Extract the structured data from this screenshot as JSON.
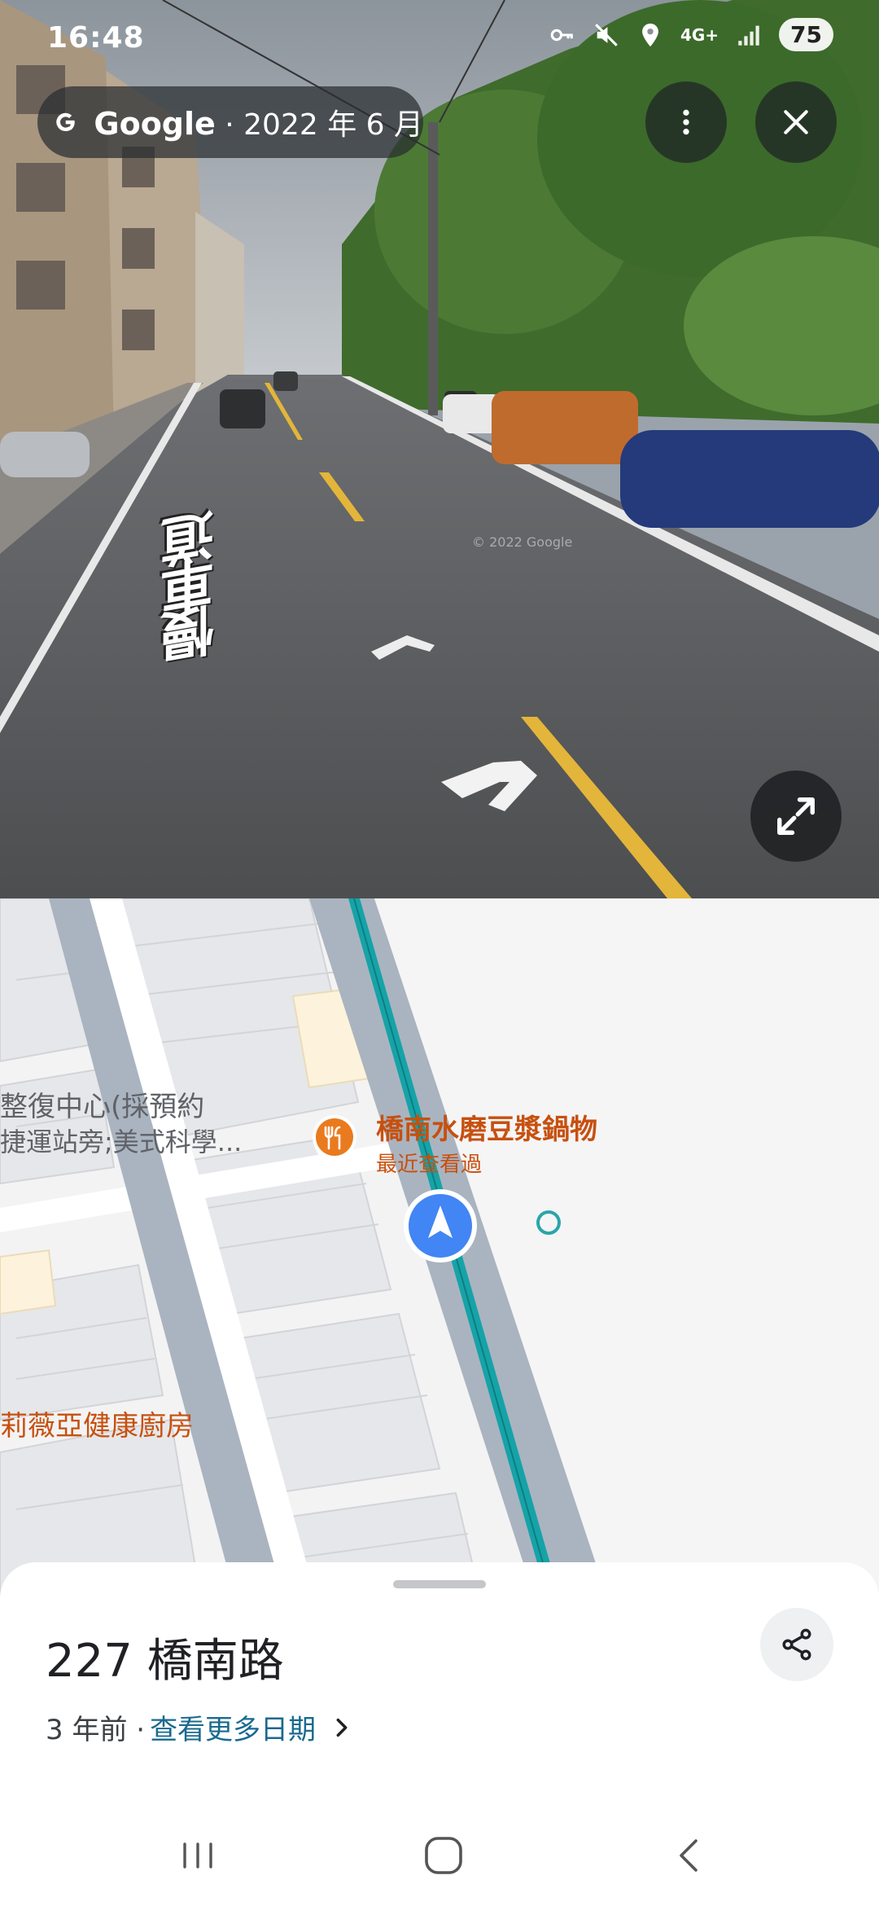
{
  "status_bar": {
    "time": "16:48",
    "battery": "75",
    "network": "4G+",
    "icons": [
      "key-icon",
      "mute-icon",
      "location-icon",
      "network-4g-icon",
      "signal-icon"
    ]
  },
  "streetview": {
    "attribution_brand": "Google",
    "attribution_date": " · 2022 年 6 月",
    "watermark": "© 2022 Google",
    "road_marking": "慢車道",
    "buttons": {
      "more": "more-vert-icon",
      "close": "close-icon",
      "expand": "expand-icon"
    }
  },
  "map": {
    "poi_left_line1": "整復中心(採預約",
    "poi_left_line2": "捷運站旁;美式科學...",
    "poi_restaurant": "橋南水磨豆漿鍋物",
    "poi_restaurant_sub": "最近查看過",
    "poi_kitchen": "莉薇亞健康廚房",
    "icons": [
      "restaurant-pin-icon",
      "navigation-arrow-icon",
      "location-ring-icon"
    ],
    "colors": {
      "route": "#1aa3a8",
      "road": "#aab4c0",
      "poi": "#c7500f"
    }
  },
  "sheet": {
    "title": "227 橋南路",
    "age": "3 年前 · ",
    "more_dates": "查看更多日期",
    "share_icon": "share-icon"
  },
  "nav_bar": {
    "icons": [
      "recents-icon",
      "home-icon",
      "back-icon"
    ]
  }
}
